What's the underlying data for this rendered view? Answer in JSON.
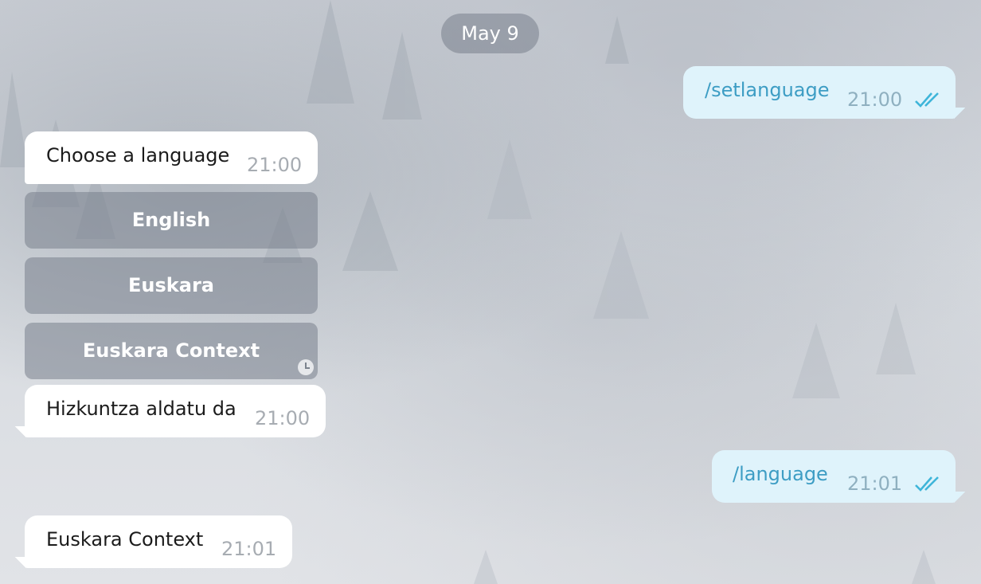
{
  "date_separator": "May 9",
  "messages": [
    {
      "direction": "outgoing",
      "text": "/setlanguage",
      "time": "21:00",
      "status_icon": "double-check-icon"
    },
    {
      "direction": "incoming",
      "text": "Choose a language",
      "time": "21:00"
    },
    {
      "direction": "incoming",
      "text": "Hizkuntza aldatu da",
      "time": "21:00"
    },
    {
      "direction": "outgoing",
      "text": "/language",
      "time": "21:01",
      "status_icon": "double-check-icon"
    },
    {
      "direction": "incoming",
      "text": "Euskara Context",
      "time": "21:01"
    }
  ],
  "inline_keyboard": {
    "buttons": [
      "English",
      "Euskara",
      "Euskara Context"
    ],
    "pending_icon": "clock-icon"
  },
  "colors": {
    "outgoing_bubble": "#dff3fb",
    "outgoing_text": "#3d9dc4",
    "check_color": "#3eb5d9",
    "incoming_bubble": "#ffffff",
    "pill_background": "rgba(120,128,140,0.55)"
  }
}
